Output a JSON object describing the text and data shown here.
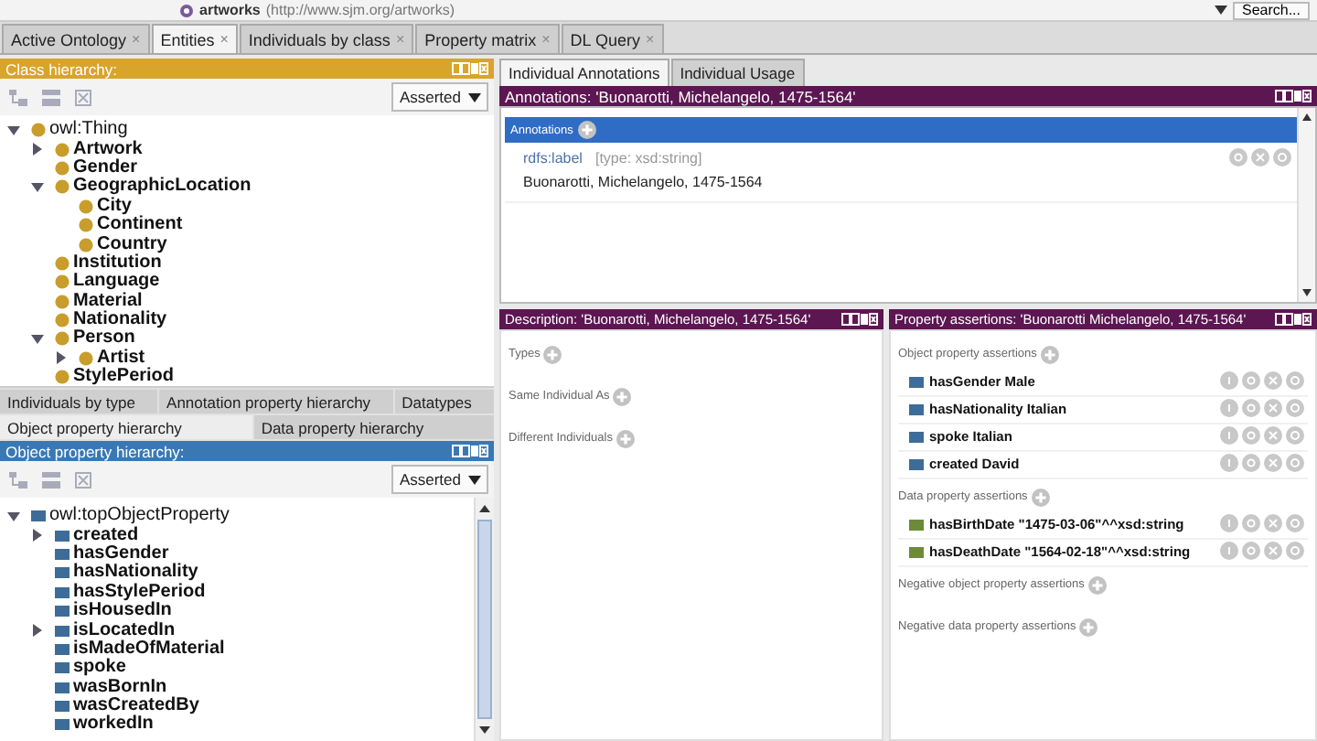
{
  "ontology_bar": {
    "name": "artworks",
    "iri": "(http://www.sjm.org/artworks)",
    "search": "Search..."
  },
  "tabs": [
    {
      "label": "Active Ontology",
      "close": "×",
      "selected": false
    },
    {
      "label": "Entities",
      "close": "×",
      "selected": true
    },
    {
      "label": "Individuals by class",
      "close": "×",
      "selected": false
    },
    {
      "label": "Property matrix",
      "close": "×",
      "selected": false
    },
    {
      "label": "DL Query",
      "close": "×",
      "selected": false
    }
  ],
  "class_hierarchy": {
    "title": "Class hierarchy:",
    "mode": "Asserted",
    "tree": [
      {
        "label": "owl:Thing",
        "expanded": true,
        "children": [
          {
            "label": "Artwork",
            "expanded": false
          },
          {
            "label": "Gender"
          },
          {
            "label": "GeographicLocation",
            "expanded": true,
            "children": [
              {
                "label": "City"
              },
              {
                "label": "Continent"
              },
              {
                "label": "Country"
              }
            ]
          },
          {
            "label": "Institution"
          },
          {
            "label": "Language"
          },
          {
            "label": "Material"
          },
          {
            "label": "Nationality"
          },
          {
            "label": "Person",
            "expanded": true,
            "children": [
              {
                "label": "Artist",
                "expanded": false
              }
            ]
          },
          {
            "label": "StylePeriod"
          }
        ]
      }
    ]
  },
  "hierarchy_tabs": [
    [
      {
        "label": "Individuals by type",
        "selected": false
      },
      {
        "label": "Annotation property hierarchy",
        "selected": false
      },
      {
        "label": "Datatypes",
        "selected": false
      }
    ],
    [
      {
        "label": "Object property hierarchy",
        "selected": true
      },
      {
        "label": "Data property hierarchy",
        "selected": false
      }
    ]
  ],
  "object_property_hierarchy": {
    "title": "Object property hierarchy:",
    "mode": "Asserted",
    "tree": [
      {
        "label": "owl:topObjectProperty",
        "expanded": true,
        "children": [
          {
            "label": "created",
            "expanded": false
          },
          {
            "label": "hasGender"
          },
          {
            "label": "hasNationality"
          },
          {
            "label": "hasStylePeriod"
          },
          {
            "label": "isHousedIn"
          },
          {
            "label": "isLocatedIn",
            "expanded": false
          },
          {
            "label": "isMadeOfMaterial"
          },
          {
            "label": "spoke"
          },
          {
            "label": "wasBornIn"
          },
          {
            "label": "wasCreatedBy"
          },
          {
            "label": "workedIn"
          }
        ]
      }
    ]
  },
  "individual_tabs": [
    {
      "label": "Individual Annotations",
      "selected": true
    },
    {
      "label": "Individual Usage",
      "selected": false
    }
  ],
  "annotations": {
    "title": "Annotations: 'Buonarotti, Michelangelo, 1475-1564'",
    "section": "Annotations",
    "items": [
      {
        "property": "rdfs:label",
        "type": "[type: xsd:string]",
        "value": "Buonarotti, Michelangelo, 1475-1564"
      }
    ]
  },
  "description": {
    "title": "Description: 'Buonarotti, Michelangelo, 1475-1564'",
    "sections": [
      "Types",
      "Same Individual As",
      "Different Individuals"
    ]
  },
  "property_assertions": {
    "title": "Property assertions: 'Buonarotti Michelangelo, 1475-1564'",
    "sections": [
      {
        "label": "Object property assertions",
        "kind": "object",
        "items": [
          {
            "property": "hasGender",
            "value": "Male"
          },
          {
            "property": "hasNationality",
            "value": "Italian"
          },
          {
            "property": "spoke",
            "value": "Italian"
          },
          {
            "property": "created",
            "value": "David"
          }
        ]
      },
      {
        "label": "Data property assertions",
        "kind": "data",
        "items": [
          {
            "property": "hasBirthDate",
            "value": "\"1475-03-06\"^^xsd:string"
          },
          {
            "property": "hasDeathDate",
            "value": "\"1564-02-18\"^^xsd:string"
          }
        ]
      },
      {
        "label": "Negative object property assertions"
      },
      {
        "label": "Negative data property assertions"
      }
    ]
  }
}
